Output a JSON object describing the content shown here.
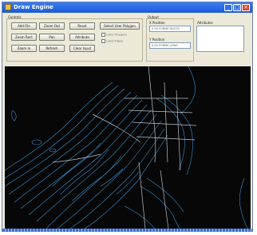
{
  "window": {
    "title": "Draw Engine"
  },
  "controls": {
    "group_label": "Controls",
    "buttons": [
      "Add File",
      "Zoom Out",
      "Reset",
      "Zoom Rect",
      "Pan",
      "Attribute",
      "Zoom In",
      "Refresh",
      "Clear Input"
    ],
    "select_user_polygon": "Select User Polygon",
    "checkbox_1": "Label Polygons",
    "checkbox_2": "Label Edges"
  },
  "output": {
    "group_label": "Output",
    "x_label": "X Position",
    "x_value": "0.00 FORMS ROOTS",
    "y_label": "Y Position",
    "y_value": "0.00 FORMS LOWS"
  },
  "attributes": {
    "label": "Attributes"
  },
  "colors": {
    "titlebar": "#1a5ad6",
    "map_background": "#070707",
    "contours": "#3aa0e6",
    "roads": "#d8e4ec"
  }
}
